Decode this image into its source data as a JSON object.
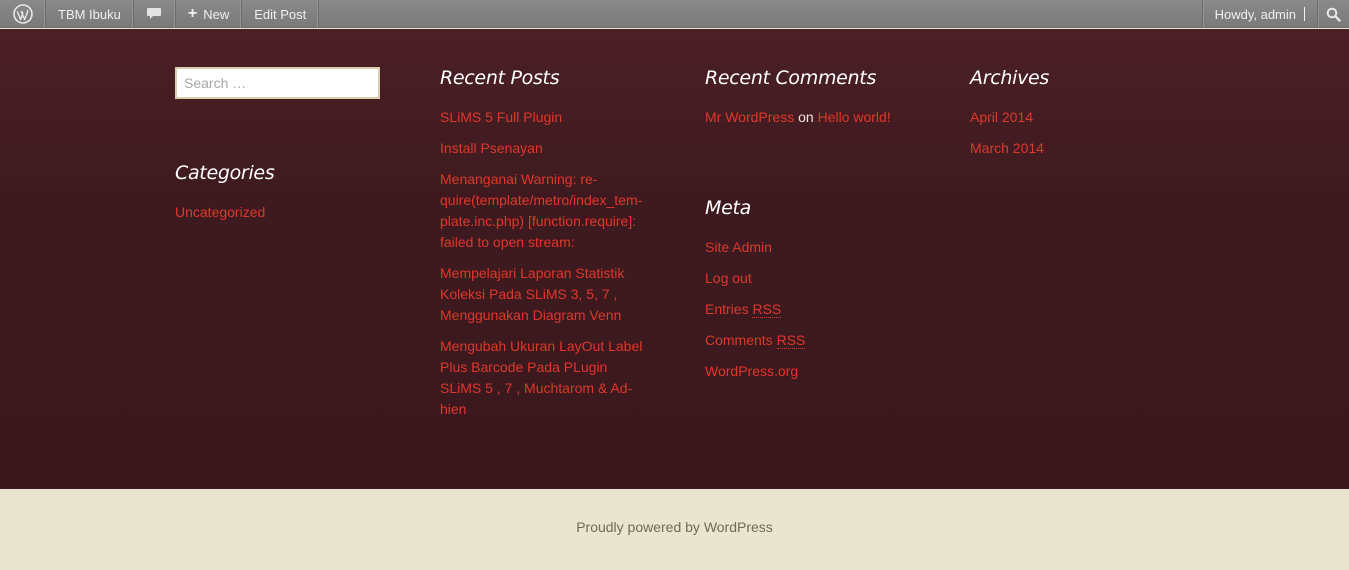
{
  "adminbar": {
    "site_name": "TBM Ibuku",
    "new_label": "New",
    "edit_post_label": "Edit Post",
    "howdy": "Howdy, admin"
  },
  "search": {
    "placeholder": "Search …"
  },
  "categories": {
    "title": "Categories",
    "items": [
      "Uncategorized"
    ]
  },
  "recent_posts": {
    "title": "Recent Posts",
    "items": [
      "SLiMS 5 Full Plugin",
      "Install Psenayan",
      "Menanganai Warning: re-quire(template/metro/index_tem-plate.inc.php) [function.require]: failed to open stream:",
      "Mempelajari Laporan Statistik Koleksi Pada SLiMS 3, 5, 7 , Menggunakan Diagram Venn",
      "Mengubah Ukuran LayOut Label Plus Barcode Pada PLugin SLiMS 5 , 7 , Muchtarom & Ad-hien"
    ]
  },
  "recent_comments": {
    "title": "Recent Comments",
    "author": "Mr WordPress",
    "on": "on",
    "post": "Hello world!"
  },
  "meta": {
    "title": "Meta",
    "site_admin": "Site Admin",
    "log_out": "Log out",
    "entries": "Entries",
    "comments": "Comments",
    "rss": "RSS",
    "wordpress_org": "WordPress.org"
  },
  "archives": {
    "title": "Archives",
    "items": [
      "April 2014",
      "March 2014"
    ]
  },
  "footer": {
    "credit": "Proudly powered by WordPress"
  },
  "colors": {
    "link": "#e0372b",
    "widget_bg": "#3d1a1f",
    "footer_bg": "#e9e5ce",
    "adminbar": "#7f7f7f"
  }
}
